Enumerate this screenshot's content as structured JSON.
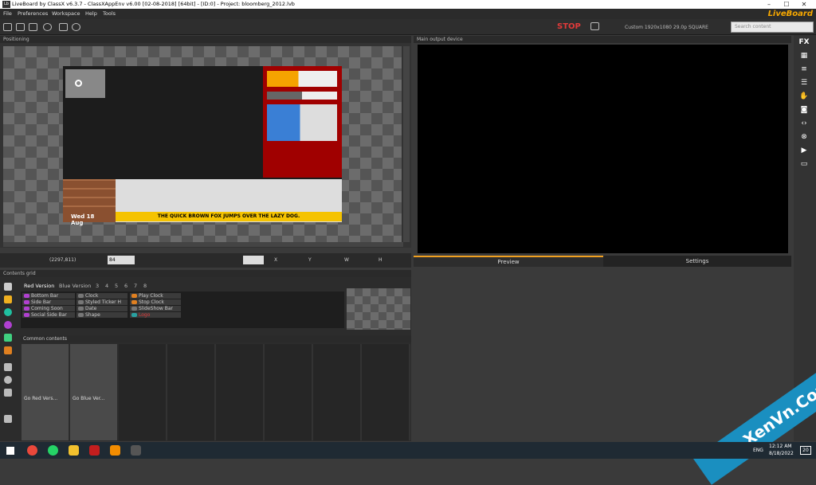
{
  "window": {
    "title": "LiveBoard by ClassX v6.3.7 - ClassXAppEnv v6.00 [02-08-2018] [64bit] - [ID:0] - Project: bloomberg_2012.lvb",
    "app_icon": "lb-icon",
    "minimize": "–",
    "maximize": "☐",
    "close": "✕"
  },
  "menu": [
    "File",
    "Preferences",
    "Workspace",
    "Help",
    "Tools"
  ],
  "brand": "LiveBoard",
  "toolbar": {
    "stop_label": "STOP",
    "resolution": "Custom 1920x1080 29.0p SQUARE",
    "search_placeholder": "Search content"
  },
  "positioning": {
    "title": "Positioning",
    "coords": "(2297,811)",
    "zoom": "84",
    "labels": [
      "X",
      "Y",
      "W",
      "H"
    ],
    "canvas": {
      "ticker_text": "THE QUICK BROWN FOX JUMPS OVER THE LAZY DOG.",
      "date_text": "Wed 18 Aug"
    }
  },
  "main_output": {
    "title": "Main output device",
    "tabs": [
      "Preview",
      "Settings"
    ]
  },
  "contents_grid": {
    "title": "Contents grid",
    "tabs": [
      "Red Version",
      "Blue Version",
      "3",
      "4",
      "5",
      "6",
      "7",
      "8"
    ],
    "col1": [
      "Bottom Bar",
      "Side Bar",
      "Coming Soon",
      "Social Side Bar"
    ],
    "col2": [
      "Clock",
      "Styled Ticker H",
      "Date",
      "Shape"
    ],
    "col3": [
      "Play Clock",
      "Stop Clock",
      "SlideShow Bar",
      "Logo"
    ]
  },
  "common": {
    "title": "Common contents",
    "items": [
      "Go Red Vers...",
      "Go Blue Ver..."
    ]
  },
  "right_sidebar": {
    "fx_label": "FX"
  },
  "taskbar": {
    "time": "12:12 AM",
    "date": "8/18/2022",
    "lang": "ENG",
    "notif": "20"
  },
  "watermark": "XenVn.Com",
  "colors": {
    "accent": "#f0a020",
    "stop": "#e03a3a",
    "canvas_red": "#a00000",
    "ticker_yellow": "#f5c300"
  }
}
